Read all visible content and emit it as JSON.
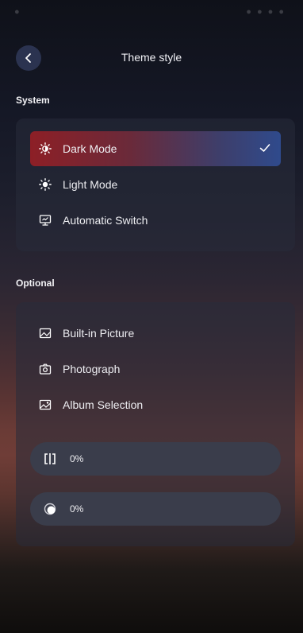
{
  "header": {
    "title": "Theme style"
  },
  "system": {
    "title": "System",
    "options": [
      {
        "label": "Dark Mode",
        "icon": "sun-half-icon",
        "selected": true
      },
      {
        "label": "Light Mode",
        "icon": "sun-icon",
        "selected": false
      },
      {
        "label": "Automatic Switch",
        "icon": "monitor-icon",
        "selected": false
      }
    ]
  },
  "optional": {
    "title": "Optional",
    "options": [
      {
        "label": "Built-in Picture",
        "icon": "image-icon"
      },
      {
        "label": "Photograph",
        "icon": "camera-icon"
      },
      {
        "label": "Album Selection",
        "icon": "album-icon"
      }
    ],
    "sliders": [
      {
        "icon": "blur-icon",
        "value_label": "0%",
        "value": 0
      },
      {
        "icon": "brightness-icon",
        "value_label": "0%",
        "value": 0
      }
    ]
  },
  "colors": {
    "selected_start": "#8d1f26",
    "selected_end": "#2f4a8c",
    "back_button": "#2b3350"
  }
}
